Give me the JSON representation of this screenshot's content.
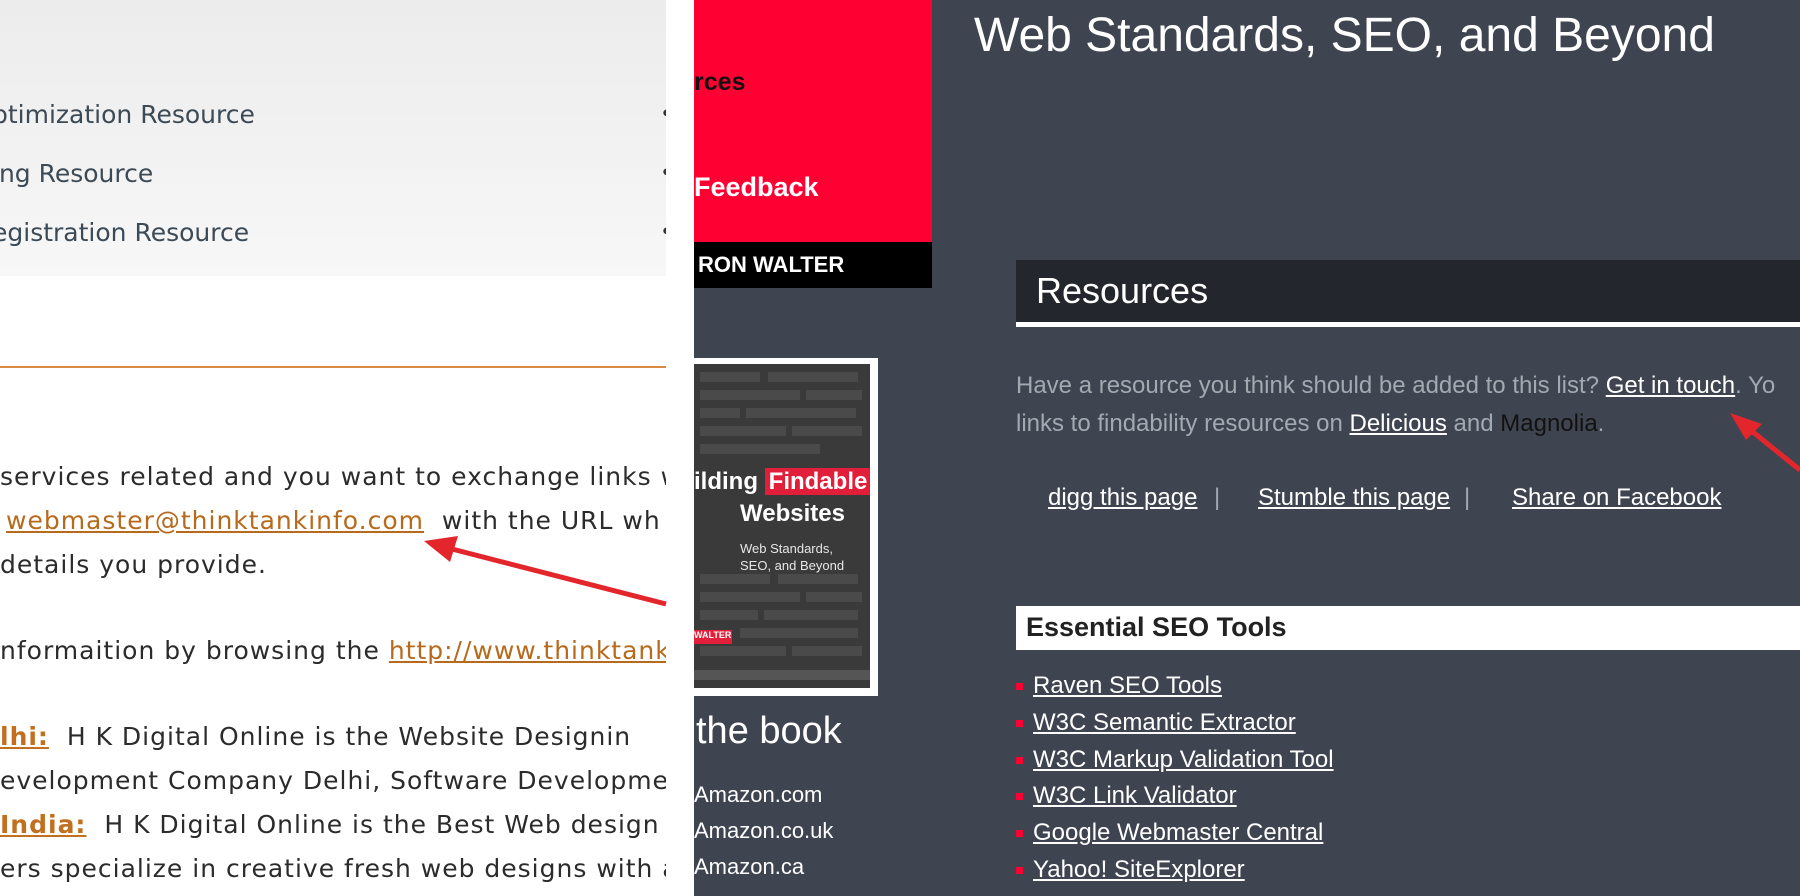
{
  "left_panel": {
    "resource_items": [
      "ptimization Resource",
      "ing Resource",
      "egistration Resource"
    ],
    "para1": {
      "text1": "services related and you want to exchange links w"
    },
    "para2": {
      "email": "webmaster@thinktankinfo.com",
      "text_after": "with the URL wh"
    },
    "para3": {
      "text": "details you provide."
    },
    "para4": {
      "text_before": "nformaition by browsing the",
      "link": "http://www.thinktankin"
    },
    "para5": {
      "link": "lhi:",
      "text": "H K Digital Online is the Website Designin"
    },
    "para6": {
      "text": "evelopment Company Delhi, Software Development"
    },
    "para7": {
      "link": "India:",
      "text": "H K Digital Online is the Best Web design"
    },
    "para8": {
      "text": "ers specialize in creative fresh web designs with ar"
    }
  },
  "middle_column": {
    "red_text_1": "rces",
    "red_text_2": "Feedback",
    "author_bar": "RON WALTER",
    "book_cover": {
      "title_highlight": "Findable",
      "title_prefix": "ilding",
      "title_line2": "Websites",
      "subtitle": "Web Standards, SEO, and Beyond",
      "author_tag": "WALTER"
    },
    "book_heading": "the book",
    "store_links": [
      "Amazon.com",
      "Amazon.co.uk",
      "Amazon.ca"
    ]
  },
  "right_panel": {
    "site_title": "Web Standards, SEO, and Beyond",
    "resources_heading": "Resources",
    "intro_line1_prefix": "Have a resource you think should be added to this list?",
    "intro_link_get_in_touch": "Get in touch",
    "intro_line1_suffix": ". Yo",
    "intro_line2_prefix": "links to findability resources on",
    "intro_link_delicious": "Delicious",
    "intro_and": "and",
    "intro_link_magnolia": "Magnolia",
    "intro_period": ".",
    "share_links": [
      "digg this page",
      "Stumble this page",
      "Share on Facebook"
    ],
    "share_separator": "|",
    "tools_heading": "Essential SEO Tools",
    "tools": [
      "Raven SEO Tools",
      "W3C Semantic Extractor",
      "W3C Markup Validation Tool",
      "W3C Link Validator",
      "Google Webmaster Central",
      "Yahoo! SiteExplorer"
    ]
  },
  "colors": {
    "accent_red": "#ff0033",
    "dark_background": "#3f4550",
    "orange_link": "#b76a1c",
    "annotation_arrow": "#e3262b"
  }
}
